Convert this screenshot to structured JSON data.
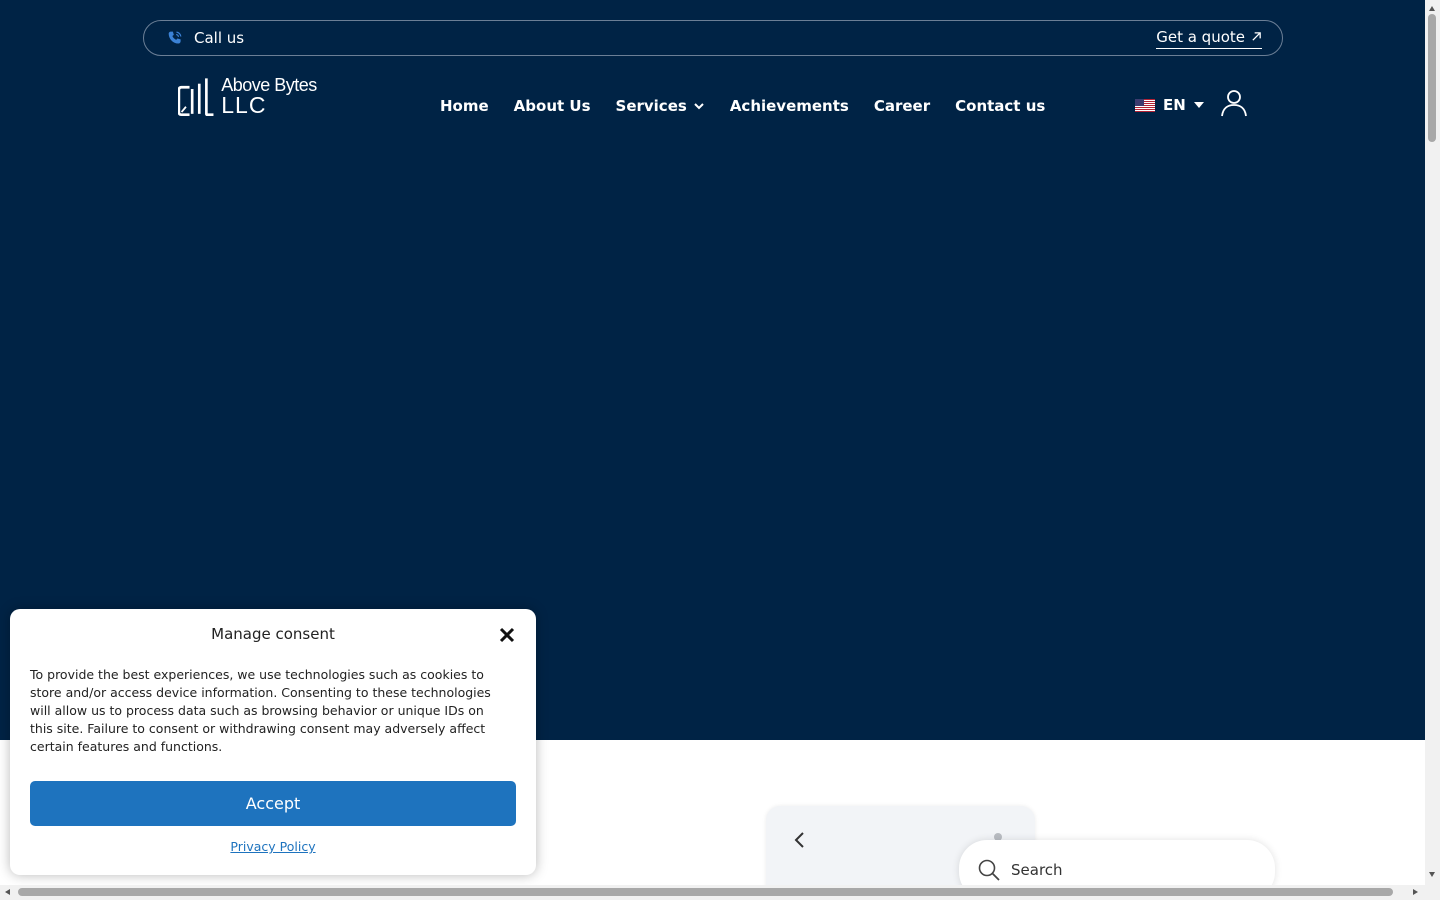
{
  "colors": {
    "hero_bg": "#002345",
    "accent": "#1e73be",
    "text_light": "#ffffff"
  },
  "topbar": {
    "call_label": "Call us",
    "call_icon": "phone-icon",
    "quote_label": "Get a quote",
    "quote_icon": "arrow-up-right-icon"
  },
  "logo": {
    "brand": "Above Bytes",
    "suffix": "LLC",
    "icon": "building-logo-icon"
  },
  "nav": {
    "items": [
      {
        "label": "Home"
      },
      {
        "label": "About Us"
      },
      {
        "label": "Services",
        "has_dropdown": true
      },
      {
        "label": "Achievements"
      },
      {
        "label": "Career"
      },
      {
        "label": "Contact us"
      }
    ]
  },
  "lang": {
    "code": "EN",
    "flag": "us-flag-icon"
  },
  "account": {
    "icon": "user-icon"
  },
  "preview": {
    "search_placeholder": "Search"
  },
  "consent": {
    "title": "Manage consent",
    "body": "To provide the best experiences, we use technologies such as cookies to store and/or access device information. Consenting to these technologies will allow us to process data such as browsing behavior or unique IDs on this site. Failure to consent or withdrawing consent may adversely affect certain features and functions.",
    "accept_label": "Accept",
    "privacy_label": "Privacy Policy"
  }
}
